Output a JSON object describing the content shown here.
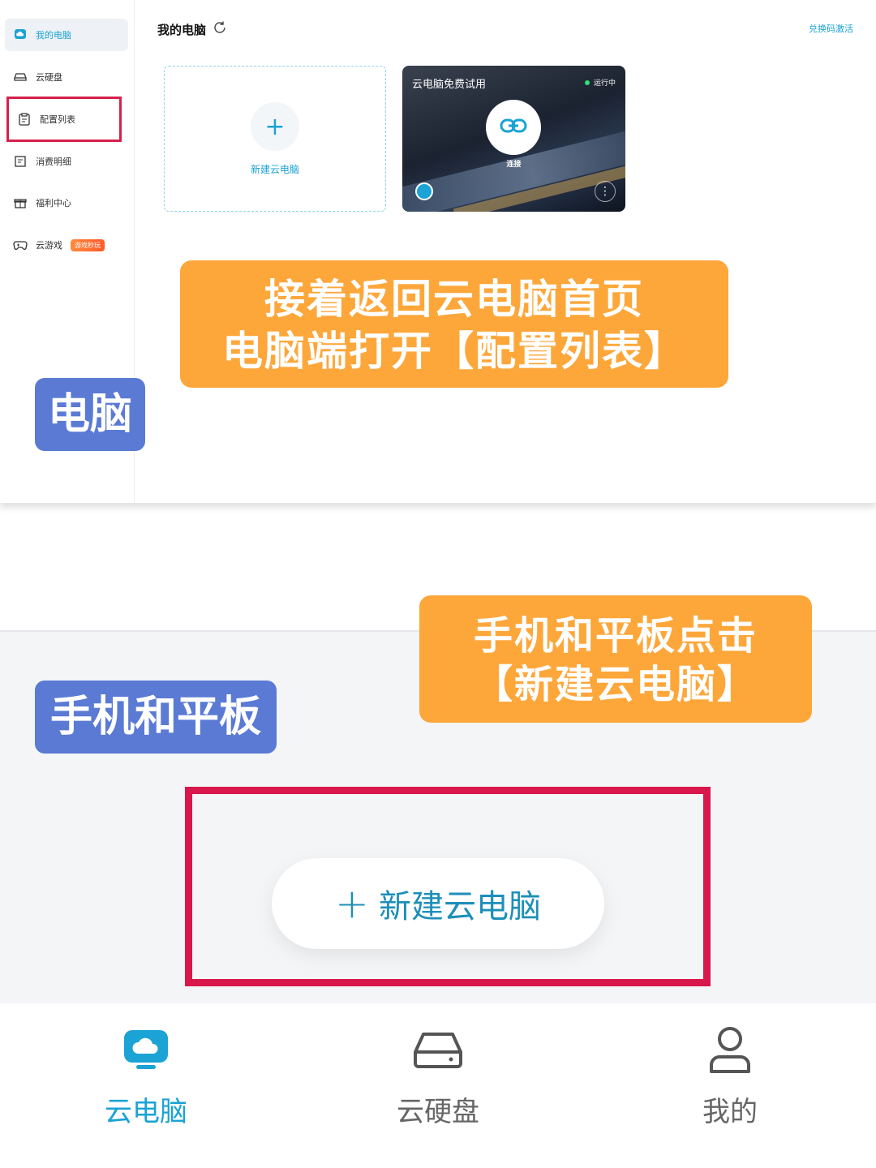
{
  "sidebar": {
    "items": [
      {
        "label": "我的电脑",
        "icon": "cloud-pc-icon"
      },
      {
        "label": "云硬盘",
        "icon": "disk-icon"
      },
      {
        "label": "配置列表",
        "icon": "clipboard-icon"
      },
      {
        "label": "消费明细",
        "icon": "receipt-icon"
      },
      {
        "label": "福利中心",
        "icon": "gift-icon"
      },
      {
        "label": "云游戏",
        "icon": "gamepad-icon",
        "badge": "游戏秒玩"
      }
    ]
  },
  "header": {
    "title": "我的电脑",
    "redeem_link": "兑换码激活"
  },
  "cards": {
    "new_pc_label": "新建云电脑",
    "trial_title": "云电脑免费试用",
    "trial_status": "运行中",
    "connect_label": "连接"
  },
  "annotations": {
    "top_banner_line1": "接着返回云电脑首页",
    "top_banner_line2": "电脑端打开【配置列表】",
    "pc_tag": "电脑",
    "mobile_tag": "手机和平板",
    "mid_banner_line1": "手机和平板点击",
    "mid_banner_line2": "【新建云电脑】"
  },
  "mobile": {
    "new_button_plus": "+",
    "new_button_label": "新建云电脑"
  },
  "tabbar": {
    "tabs": [
      {
        "label": "云电脑",
        "icon": "cloud-pc-icon",
        "active": true
      },
      {
        "label": "云硬盘",
        "icon": "disk-icon",
        "active": false
      },
      {
        "label": "我的",
        "icon": "user-icon",
        "active": false
      }
    ]
  },
  "colors": {
    "accent": "#1aa3d4",
    "highlight_red": "#d8174a",
    "banner_orange": "#fda73b",
    "tag_blue": "#5a7ad4"
  }
}
